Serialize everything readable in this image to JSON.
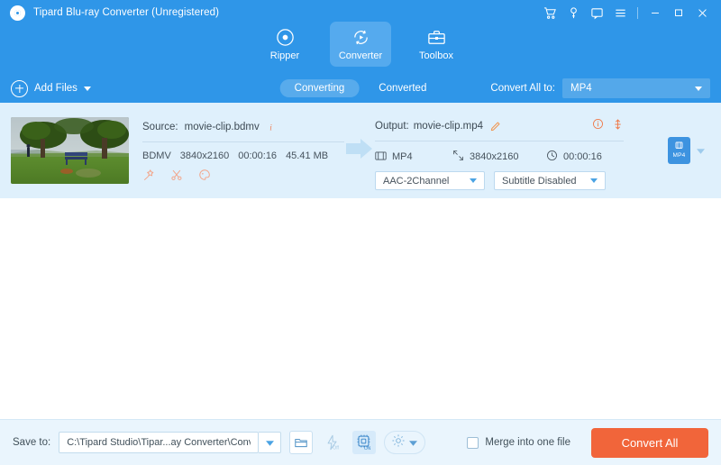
{
  "window": {
    "title": "Tipard Blu-ray Converter (Unregistered)",
    "logo_icon": "disc-logo-icon",
    "controls": [
      {
        "name": "cart-icon",
        "label": ""
      },
      {
        "name": "key-icon",
        "label": ""
      },
      {
        "name": "feedback-icon",
        "label": ""
      },
      {
        "name": "menu-icon",
        "label": ""
      },
      {
        "name": "minimize-icon",
        "label": ""
      },
      {
        "name": "maximize-icon",
        "label": ""
      },
      {
        "name": "close-icon",
        "label": ""
      }
    ]
  },
  "tabs": [
    {
      "label": "Ripper",
      "icon": "disc-icon",
      "active": false
    },
    {
      "label": "Converter",
      "icon": "convert-circular-arrow-icon",
      "active": true
    },
    {
      "label": "Toolbox",
      "icon": "toolbox-icon",
      "active": false
    }
  ],
  "toolbar": {
    "add_files_label": "Add Files",
    "add_files_icon": "plus-circle-icon",
    "add_files_caret_icon": "chevron-down-icon",
    "segments": [
      {
        "label": "Converting",
        "active": true
      },
      {
        "label": "Converted",
        "active": false
      }
    ],
    "convert_all_to_label": "Convert All to:",
    "convert_all_to_value": "MP4",
    "convert_all_to_caret_icon": "chevron-down-icon"
  },
  "file": {
    "thumbnail_name": "video-thumbnail",
    "source": {
      "prefix": "Source:",
      "filename": "movie-clip.bdmv",
      "info_icon": "info-icon",
      "format": "BDMV",
      "resolution": "3840x2160",
      "duration": "00:00:16",
      "filesize": "45.41 MB",
      "tools": [
        {
          "name": "magic-wand-edit-icon"
        },
        {
          "name": "scissors-cut-icon"
        },
        {
          "name": "palette-effect-icon"
        }
      ]
    },
    "arrow_icon": "right-arrow-icon",
    "output": {
      "prefix": "Output:",
      "filename": "movie-clip.mp4",
      "edit_icon": "pencil-edit-icon",
      "info_icon": "info-circle-icon",
      "reorder_icon": "vertical-arrows-icon",
      "format_icon": "film-strip-icon",
      "format": "MP4",
      "resolution_icon": "resize-icon",
      "resolution": "3840x2160",
      "duration_icon": "clock-icon",
      "duration": "00:00:16",
      "audio_track": "AAC-2Channel",
      "subtitle": "Subtitle Disabled",
      "dropdown_caret_icon": "chevron-down-icon"
    },
    "format_badge": {
      "label": "MP4",
      "icon": "file-format-badge-icon",
      "caret_icon": "chevron-down-icon"
    }
  },
  "footer": {
    "save_to_label": "Save to:",
    "save_to_path": "C:\\Tipard Studio\\Tipar...ay Converter\\Converted",
    "path_caret_icon": "chevron-down-icon",
    "buttons": [
      {
        "name": "open-folder-icon",
        "state": ""
      },
      {
        "name": "hardware-acceleration-icon",
        "state": "Off"
      },
      {
        "name": "gpu-chip-icon",
        "state": "ON"
      },
      {
        "name": "settings-gear-icon",
        "state": ""
      }
    ],
    "merge_label": "Merge into one file",
    "merge_checked": false,
    "convert_all_label": "Convert All"
  },
  "colors": {
    "header_blue": "#2f96e8",
    "active_tab_blue": "#55aaee",
    "row_blue": "#dff0fc",
    "footer_blue": "#eaf5fd",
    "accent_orange": "#f1653a"
  }
}
